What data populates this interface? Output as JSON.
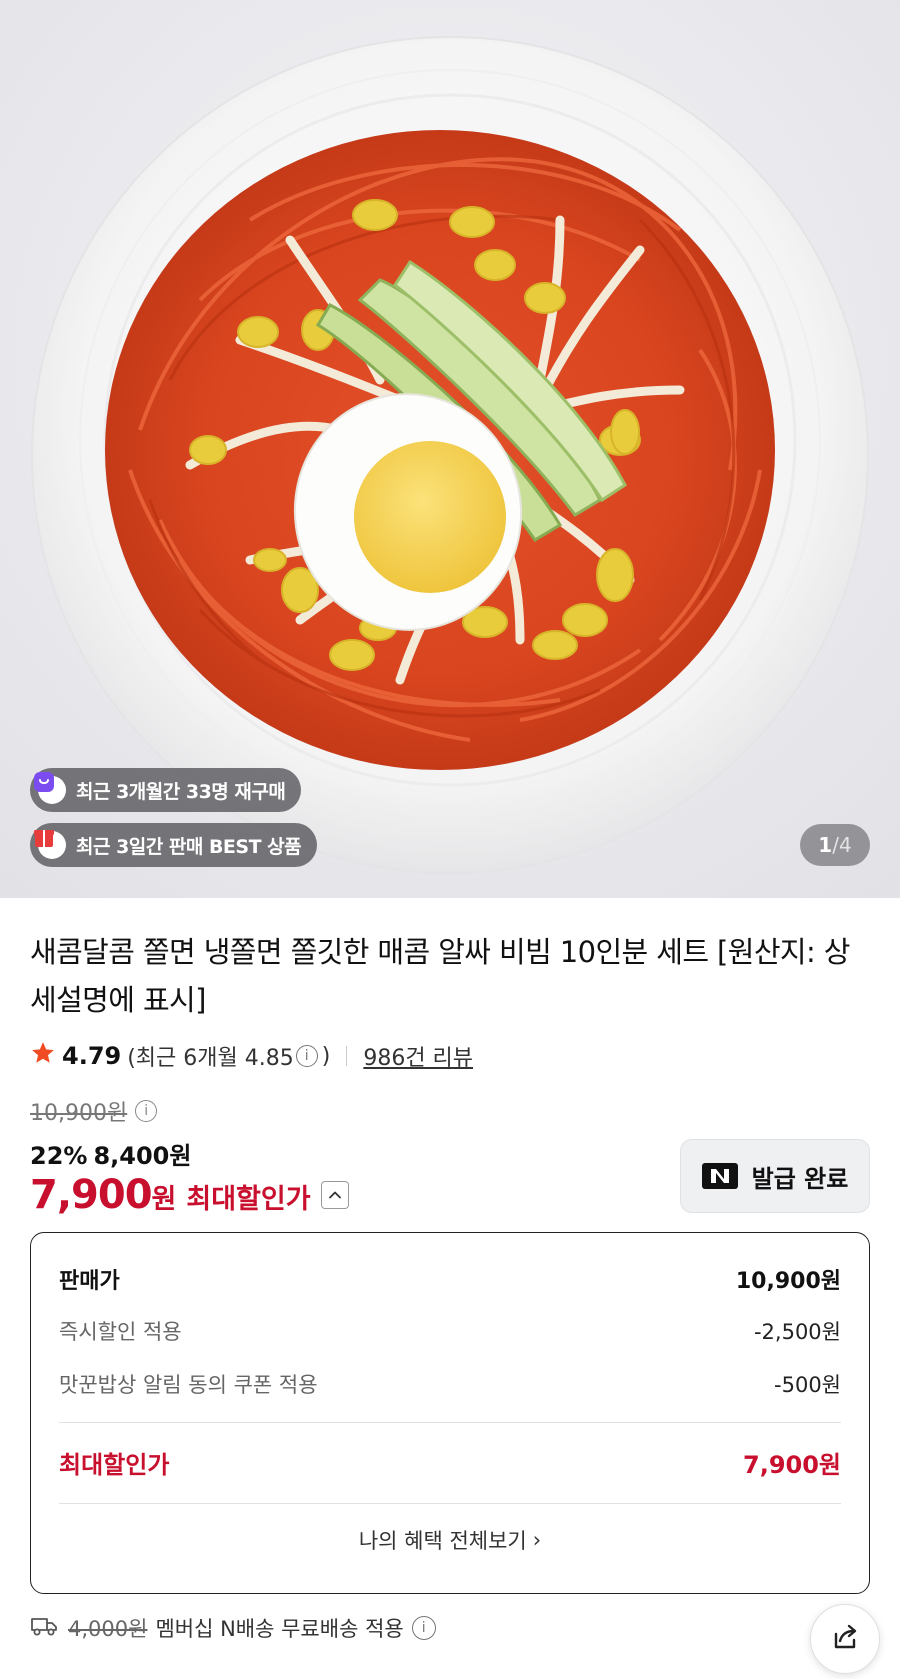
{
  "hero": {
    "badges": [
      {
        "icon": "bag-icon",
        "text": "최근 3개월간 33명 재구매"
      },
      {
        "icon": "gift-icon",
        "text": "최근 3일간 판매 BEST 상품"
      }
    ],
    "pager": {
      "current": "1",
      "separator": "/",
      "total": "4"
    }
  },
  "product": {
    "title": "새콤달콤 쫄면 냉쫄면 쫄깃한 매콤 알싸 비빔 10인분 세트 [원산지: 상세설명에 표시]"
  },
  "rating": {
    "score": "4.79",
    "recent_prefix": "(최근 6개월 4.85",
    "recent_suffix": ")",
    "info_glyph": "i",
    "reviews": "986건 리뷰"
  },
  "price": {
    "original": "10,900원",
    "info_glyph": "i",
    "discount_pct": "22%",
    "discount_price": "8,400원",
    "max_price_number": "7,900",
    "max_price_unit": "원",
    "max_price_label": "최대할인가"
  },
  "coupon": {
    "label": "발급 완료",
    "logo": "N"
  },
  "breakdown": {
    "rows": [
      {
        "label": "판매가",
        "value": "10,900원"
      },
      {
        "label": "즉시할인 적용",
        "value": "-2,500원"
      },
      {
        "label": "맛꾼밥상 알림 동의 쿠폰 적용",
        "value": "-500원"
      }
    ],
    "total": {
      "label": "최대할인가",
      "value": "7,900원"
    },
    "benefit_link": "나의 혜택 전체보기",
    "benefit_chevron": "›"
  },
  "shipping": {
    "original_fee": "4,000원",
    "text": "멤버십 N배송 무료배송 적용",
    "info_glyph": "i"
  },
  "colors": {
    "accent_red": "#c8102e",
    "star": "#f04b23",
    "badge_purple": "#7b4cf0",
    "badge_red": "#e83c3c"
  }
}
